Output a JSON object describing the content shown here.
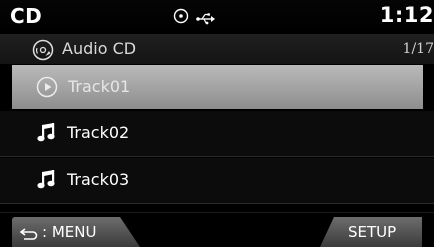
{
  "status_bar": {
    "source": "CD",
    "clock": "1:12",
    "icons": [
      "disc-icon",
      "usb-icon"
    ]
  },
  "album": {
    "title": "Audio CD",
    "track_counter": "1/17",
    "icon": "cd-icon"
  },
  "tracks": [
    {
      "label": "Track01",
      "icon": "play-circle-icon",
      "selected": true
    },
    {
      "label": "Track02",
      "icon": "music-note-icon",
      "selected": false
    },
    {
      "label": "Track03",
      "icon": "music-note-icon",
      "selected": false
    }
  ],
  "softkeys": {
    "menu_label": ": MENU",
    "setup_label": "SETUP"
  },
  "colors": {
    "background": "#000000",
    "selected_row": "#a8a8a8",
    "softkey": "#555555"
  }
}
